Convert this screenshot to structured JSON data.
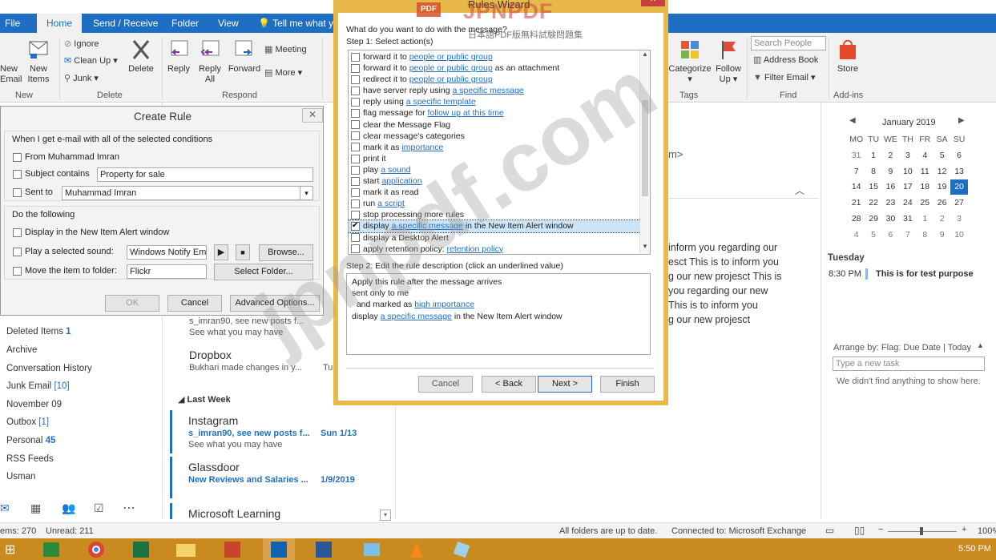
{
  "tabs": [
    "File",
    "Home",
    "Send / Receive",
    "Folder",
    "View"
  ],
  "tell_me": "Tell me what yo",
  "ribbon": {
    "new_email": "New\nEmail",
    "new_items": "New\nItems",
    "group_new": "New",
    "ignore": "Ignore",
    "clean_up": "Clean Up",
    "junk": "Junk",
    "delete": "Delete",
    "group_delete": "Delete",
    "reply": "Reply",
    "reply_all": "Reply\nAll",
    "forward": "Forward",
    "meeting": "Meeting",
    "more": "More",
    "group_respond": "Respond",
    "categorize": "Categorize",
    "follow_up": "Follow\nUp",
    "group_tags": "Tags",
    "search_people": "Search People",
    "address_book": "Address Book",
    "filter_email": "Filter Email",
    "group_find": "Find",
    "store": "Store",
    "group_addins": "Add-ins"
  },
  "create_rule": {
    "title": "Create Rule",
    "conditions_header": "When I get e-mail with all of the selected conditions",
    "from_label": "From Muhammad Imran",
    "subject_label": "Subject contains",
    "subject_value": "Property for sale",
    "sent_label": "Sent to",
    "sent_value": "Muhammad Imran",
    "do_header": "Do the following",
    "display_alert": "Display in the New Item Alert window",
    "play_sound": "Play a selected sound:",
    "sound_value": "Windows Notify Em",
    "browse": "Browse...",
    "move_item": "Move the item to folder:",
    "folder_value": "Flickr",
    "select_folder": "Select Folder...",
    "ok": "OK",
    "cancel": "Cancel",
    "advanced": "Advanced Options..."
  },
  "wizard": {
    "title": "Rules Wizard",
    "question": "What do you want to do with the message?",
    "step1": "Step 1: Select action(s)",
    "actions": [
      {
        "pre": "forward it to ",
        "link": "people or public group",
        "post": ""
      },
      {
        "pre": "forward it to ",
        "link": "people or public group",
        "post": " as an attachment"
      },
      {
        "pre": "redirect it to ",
        "link": "people or public group",
        "post": ""
      },
      {
        "pre": "have server reply using ",
        "link": "a specific message",
        "post": ""
      },
      {
        "pre": "reply using ",
        "link": "a specific template",
        "post": ""
      },
      {
        "pre": "flag message for ",
        "link": "follow up at this time",
        "post": ""
      },
      {
        "pre": "clear the Message Flag",
        "link": "",
        "post": ""
      },
      {
        "pre": "clear message's categories",
        "link": "",
        "post": ""
      },
      {
        "pre": "mark it as ",
        "link": "importance",
        "post": ""
      },
      {
        "pre": "print it",
        "link": "",
        "post": ""
      },
      {
        "pre": "play ",
        "link": "a sound",
        "post": ""
      },
      {
        "pre": "start ",
        "link": "application",
        "post": ""
      },
      {
        "pre": "mark it as read",
        "link": "",
        "post": ""
      },
      {
        "pre": "run ",
        "link": "a script",
        "post": ""
      },
      {
        "pre": "stop processing more rules",
        "link": "",
        "post": ""
      },
      {
        "pre": "display ",
        "link": "a specific message",
        "post": " in the New Item Alert window",
        "checked": true
      },
      {
        "pre": "display a Desktop Alert",
        "link": "",
        "post": ""
      },
      {
        "pre": "apply retention policy: ",
        "link": "retention policy",
        "post": ""
      }
    ],
    "step2": "Step 2: Edit the rule description (click an underlined value)",
    "desc": [
      {
        "pre": "Apply this rule after the message arrives",
        "link": "",
        "post": ""
      },
      {
        "pre": "sent only to me",
        "link": "",
        "post": ""
      },
      {
        "pre": "  and marked as ",
        "link": "high importance",
        "post": ""
      },
      {
        "pre": "display ",
        "link": "a specific message",
        "post": " in the New Item Alert window"
      }
    ],
    "cancel": "Cancel",
    "back": "< Back",
    "next": "Next >",
    "finish": "Finish"
  },
  "folders": [
    {
      "name": "Deleted Items",
      "count": "1"
    },
    {
      "name": "Archive",
      "count": ""
    },
    {
      "name": "Conversation History",
      "count": ""
    },
    {
      "name": "Junk Email",
      "count": "[10]"
    },
    {
      "name": "November 09",
      "count": ""
    },
    {
      "name": "Outbox",
      "count": "[1]"
    },
    {
      "name": "Personal",
      "count": "45"
    },
    {
      "name": "RSS Feeds",
      "count": ""
    },
    {
      "name": "Usman",
      "count": ""
    }
  ],
  "messages": {
    "row0_pre": "See what you may have",
    "row0_sub": "s_imran90, see new posts f...",
    "dropbox_from": "Dropbox",
    "dropbox_pre": "Bukhari made changes in y...",
    "dropbox_date": "Tu",
    "last_week": "Last Week",
    "insta_from": "Instagram",
    "insta_sub": "s_imran90, see new posts f...",
    "insta_date": "Sun 1/13",
    "insta_pre": "See what you may have",
    "glass_from": "Glassdoor",
    "glass_sub": "New Reviews and Salaries ...",
    "glass_date": "1/9/2019",
    "ms_from": "Microsoft Learning"
  },
  "reading": {
    "snippet_top": "m>",
    "lines": [
      "inform you regarding our",
      "esct This is to inform you",
      "g our new projesct This is",
      "you regarding our new",
      "This is to inform you",
      "g our new projesct"
    ]
  },
  "calendar": {
    "month": "January 2019",
    "days": [
      "MO",
      "TU",
      "WE",
      "TH",
      "FR",
      "SA",
      "SU"
    ],
    "weeks": [
      [
        "31",
        "1",
        "2",
        "3",
        "4",
        "5",
        "6"
      ],
      [
        "7",
        "8",
        "9",
        "10",
        "11",
        "12",
        "13"
      ],
      [
        "14",
        "15",
        "16",
        "17",
        "18",
        "19",
        "20"
      ],
      [
        "21",
        "22",
        "23",
        "24",
        "25",
        "26",
        "27"
      ],
      [
        "28",
        "29",
        "30",
        "31",
        "1",
        "2",
        "3"
      ],
      [
        "4",
        "5",
        "6",
        "7",
        "8",
        "9",
        "10"
      ]
    ],
    "agenda_day": "Tuesday",
    "agenda_time": "8:30 PM",
    "agenda_title": "This is for test purpose"
  },
  "tasks": {
    "arrange": "Arrange by: Flag: Due Date",
    "today": "Today",
    "new_task": "Type a new task",
    "empty": "We didn't find anything to show here."
  },
  "status": {
    "items": "ems: 270",
    "unread": "Unread: 211",
    "sync": "All folders are up to date.",
    "connected": "Connected to: Microsoft Exchange",
    "zoom": "100%"
  },
  "watermark": {
    "brand": "JPNPDF",
    "sub": "日本語PDF版無料試験問題集",
    "big": "jpnpdf.com"
  },
  "taskbar": {
    "time": "5:50 PM"
  },
  "colors": {
    "accent": "#1e6fc4",
    "taskbar": "#c98a1f",
    "wizard_border": "#e8b84a"
  }
}
